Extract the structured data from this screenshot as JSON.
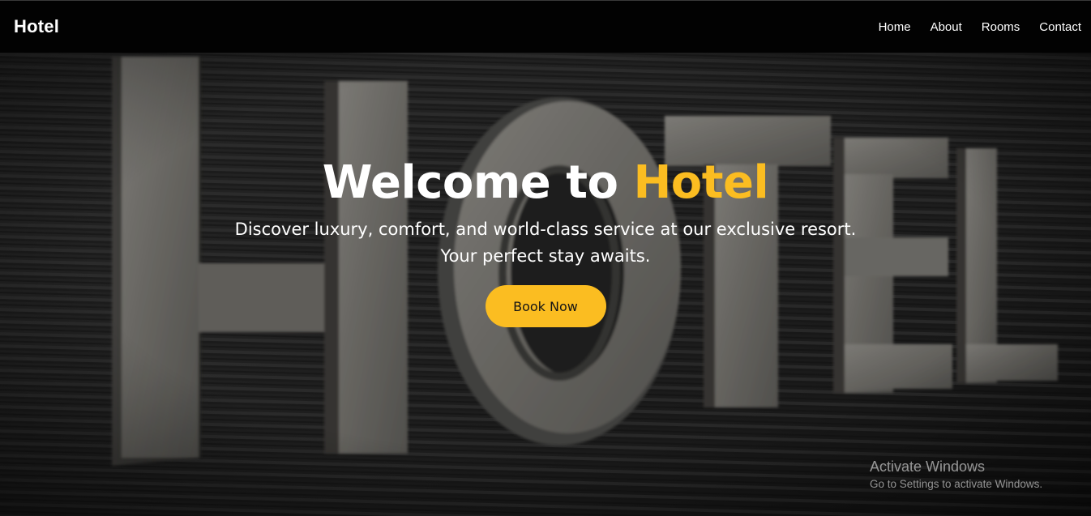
{
  "navbar": {
    "brand": "Hotel",
    "links": [
      {
        "label": "Home"
      },
      {
        "label": "About"
      },
      {
        "label": "Rooms"
      },
      {
        "label": "Contact"
      }
    ]
  },
  "hero": {
    "title_main": "Welcome to ",
    "title_accent": "Hotel",
    "subtitle": "Discover luxury, comfort, and world-class service at our exclusive resort. Your perfect stay awaits.",
    "cta_label": "Book Now",
    "background_sign_text": "HOTEL"
  },
  "watermark": {
    "title": "Activate Windows",
    "subtitle": "Go to Settings to activate Windows."
  },
  "colors": {
    "accent": "#fbbd21",
    "navbar_bg": "#020202",
    "text_light": "#ffffff"
  }
}
